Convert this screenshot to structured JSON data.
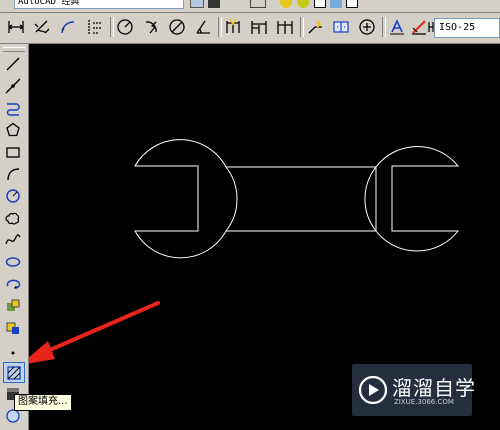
{
  "workspace": {
    "selected": "AutoCAD 经典"
  },
  "dimension_toolbar": {
    "items": [
      {
        "name": "linear-dim-icon"
      },
      {
        "name": "aligned-dim-icon"
      },
      {
        "name": "arc-length-dim-icon"
      },
      {
        "name": "ordinate-dim-icon"
      },
      {
        "name": "radius-dim-icon"
      },
      {
        "name": "jogged-dim-icon"
      },
      {
        "name": "diameter-dim-icon"
      },
      {
        "name": "angular-dim-icon"
      },
      {
        "name": "quick-dim-icon"
      },
      {
        "name": "baseline-dim-icon"
      },
      {
        "name": "continue-dim-icon"
      },
      {
        "name": "quick-leader-icon"
      },
      {
        "name": "tolerance-icon"
      },
      {
        "name": "center-mark-icon"
      },
      {
        "name": "dimedit-icon"
      },
      {
        "name": "dimtedit-icon"
      },
      {
        "name": "dim-update-icon"
      }
    ],
    "dim_style": "ISO-25"
  },
  "draw_toolbar": {
    "tools": [
      {
        "name": "line-tool-icon"
      },
      {
        "name": "construction-line-tool-icon"
      },
      {
        "name": "polyline-tool-icon"
      },
      {
        "name": "polygon-tool-icon"
      },
      {
        "name": "rectangle-tool-icon"
      },
      {
        "name": "arc-tool-icon"
      },
      {
        "name": "circle-tool-icon"
      },
      {
        "name": "revision-cloud-tool-icon"
      },
      {
        "name": "spline-tool-icon"
      },
      {
        "name": "ellipse-tool-icon"
      },
      {
        "name": "ellipse-arc-tool-icon"
      },
      {
        "name": "insert-block-tool-icon"
      },
      {
        "name": "make-block-tool-icon"
      },
      {
        "name": "point-tool-icon"
      },
      {
        "name": "hatch-tool-icon"
      },
      {
        "name": "gradient-tool-icon"
      },
      {
        "name": "region-tool-icon"
      }
    ],
    "active_tool": "hatch-tool-icon"
  },
  "tooltip": {
    "text": "图案填充..."
  },
  "colors": {
    "toolbar_bg": "#d4d0c8",
    "canvas_bg": "#000000",
    "geometry": "#ffffff",
    "arrow": "#e8241c",
    "tooltip_bg": "#ffffe1"
  },
  "watermark": {
    "title": "溜溜自学",
    "subtitle": "ZIXUE.3066.COM"
  }
}
